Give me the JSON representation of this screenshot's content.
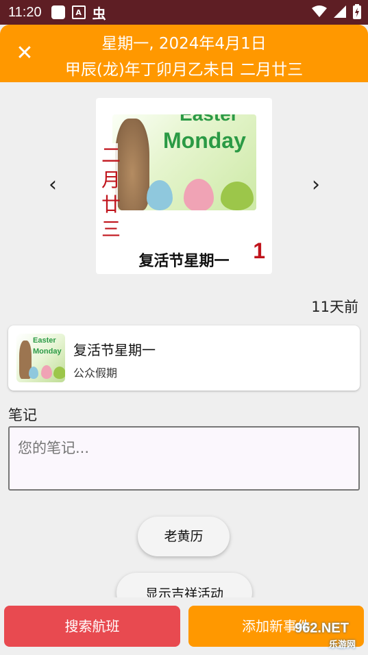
{
  "status_bar": {
    "time": "11:20",
    "a_icon_label": "A",
    "bug_icon_glyph": "虫"
  },
  "header": {
    "close_glyph": "✕",
    "date_line": "星期一, 2024年4月1日",
    "lunar_line": "甲辰(龙)年丁卯月乙未日 二月廿三"
  },
  "navigation": {
    "prev_glyph": "‹",
    "next_glyph": "›"
  },
  "feature_card": {
    "image_text_top": "Easter",
    "image_text": "Monday",
    "lunar_vertical": "二月廿三",
    "holiday_name": "复活节星期一",
    "day_number": "1"
  },
  "relative_time": "11天前",
  "holiday_item": {
    "thumb_text_1": "Easter",
    "thumb_text_2": "Monday",
    "title": "复活节星期一",
    "subtitle": "公众假期"
  },
  "notes": {
    "label": "笔记",
    "placeholder": "您的笔记..."
  },
  "buttons": {
    "almanac": "老黄历",
    "auspicious": "显示吉祥活动",
    "search_flights": "搜索航班",
    "add_new": "添加新事件"
  },
  "watermark": {
    "text": "962.NET",
    "subtext": "乐游网"
  },
  "colors": {
    "accent": "#ff9800",
    "status_bar": "#5e1e24",
    "search_button": "#e84a50",
    "lunar_red": "#c0141c"
  }
}
